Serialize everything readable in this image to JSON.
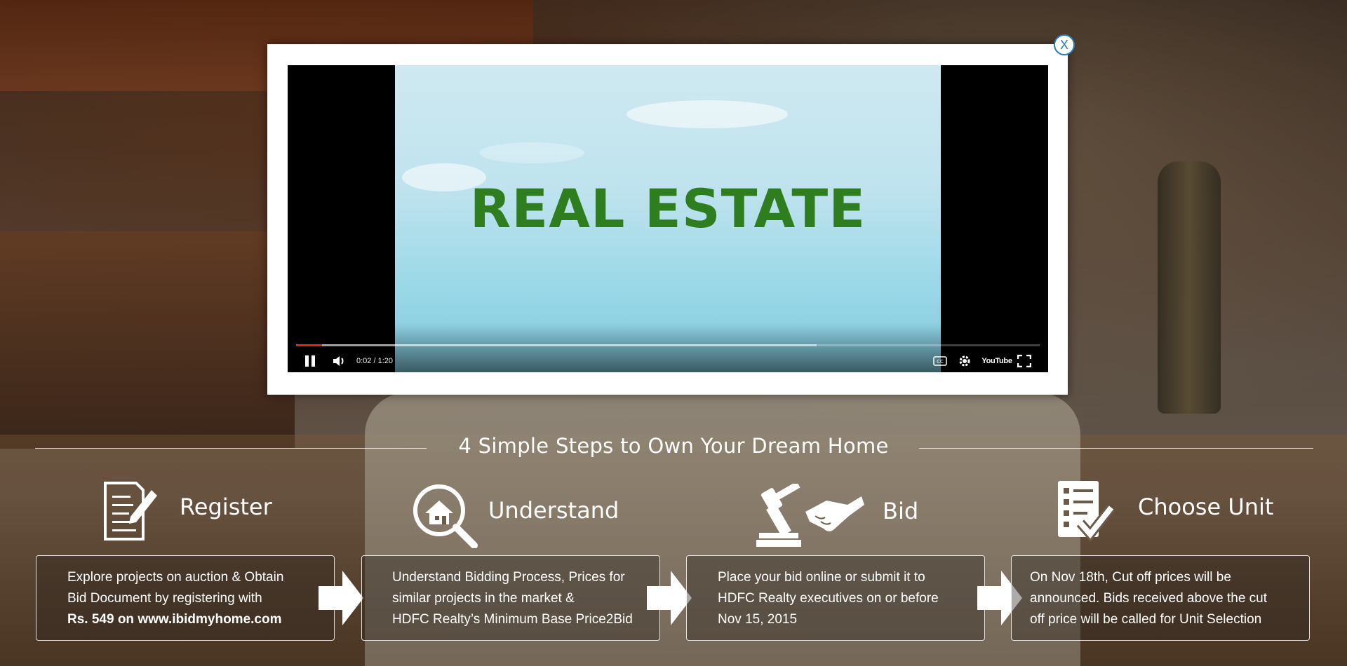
{
  "modal": {
    "close_label": "X",
    "video": {
      "title_text": "REAL ESTATE",
      "time_current": "0:02",
      "time_total": "1:20",
      "played_fraction": 0.035,
      "loaded_fraction": 0.7,
      "controls": {
        "play_pause_icon": "pause-icon",
        "volume_icon": "volume-icon",
        "cc_icon": "captions-icon",
        "settings_icon": "gear-icon",
        "youtube_logo": "YouTube",
        "fullscreen_icon": "fullscreen-icon"
      }
    }
  },
  "steps": {
    "heading": "4 Simple Steps to Own Your Dream Home",
    "items": [
      {
        "title": "Register",
        "icon": "document-pen-icon",
        "lines": [
          "Explore projects on auction & Obtain",
          "Bid Document by registering with"
        ],
        "bold_line": "Rs. 549 on www.ibidmyhome.com"
      },
      {
        "title": "Understand",
        "icon": "magnifier-house-icon",
        "lines": [
          "Understand Bidding Process, Prices for",
          "similar projects in the market &",
          "HDFC Realty’s Minimum Base Price2Bid"
        ]
      },
      {
        "title": "Bid",
        "icon": "gavel-handshake-icon",
        "lines": [
          "Place your bid online or submit it to",
          "HDFC Realty executives on or before",
          "Nov 15, 2015"
        ]
      },
      {
        "title": "Choose Unit",
        "icon": "checklist-icon",
        "lines": [
          "On Nov 18th, Cut off prices will be",
          "announced. Bids received above the cut",
          "off price will be called for Unit Selection"
        ]
      }
    ]
  }
}
